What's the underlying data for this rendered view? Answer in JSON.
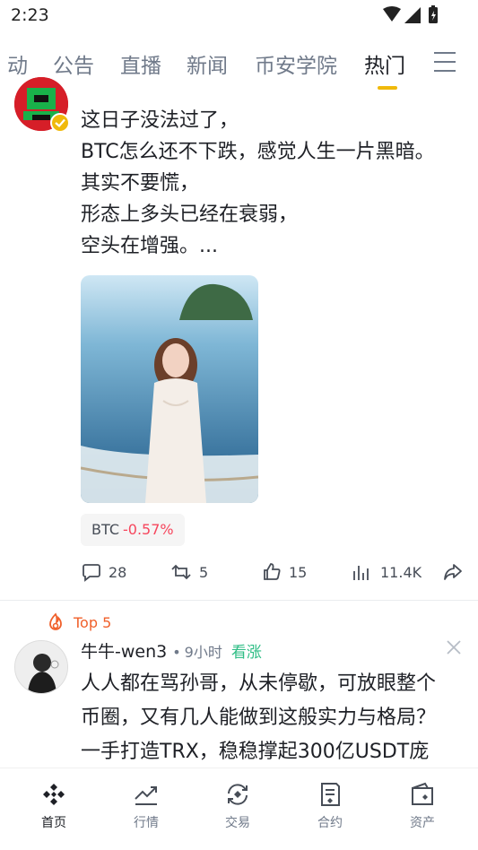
{
  "status_bar": {
    "time": "2:23"
  },
  "tabs": [
    {
      "label": "动"
    },
    {
      "label": "公告"
    },
    {
      "label": "直播"
    },
    {
      "label": "新闻"
    },
    {
      "label": "币安学院"
    },
    {
      "label": "热门",
      "active": true
    }
  ],
  "post1": {
    "lines": [
      "这日子没法过了，",
      "BTC怎么还不下跌，感觉人生一片黑暗。",
      "其实不要慌，",
      "形态上多头已经在衰弱，",
      "空头在增强。..."
    ],
    "coin_tag": {
      "symbol": "BTC",
      "change": "-0.57%"
    },
    "actions": {
      "comments": "28",
      "reposts": "5",
      "likes": "15",
      "views": "11.4K"
    }
  },
  "post2": {
    "badge": "Top 5",
    "author": "牛牛-wen3",
    "dot": "•",
    "time": "9小时",
    "sentiment": "看涨",
    "lines": [
      "人人都在骂孙哥，从未停歇，可放眼整个",
      "币圈，又有几人能做到这般实力与格局？",
      "一手打造TRX，稳稳撑起300亿USDT庞"
    ]
  },
  "bottom_nav": [
    {
      "label": "首页",
      "icon": "home-icon",
      "active": true
    },
    {
      "label": "行情",
      "icon": "markets-icon"
    },
    {
      "label": "交易",
      "icon": "trade-icon"
    },
    {
      "label": "合约",
      "icon": "futures-icon"
    },
    {
      "label": "资产",
      "icon": "wallet-icon"
    }
  ],
  "colors": {
    "accent": "#f0b90b",
    "down": "#f6465d",
    "up": "#2ebd85",
    "top_badge": "#f0602b"
  }
}
